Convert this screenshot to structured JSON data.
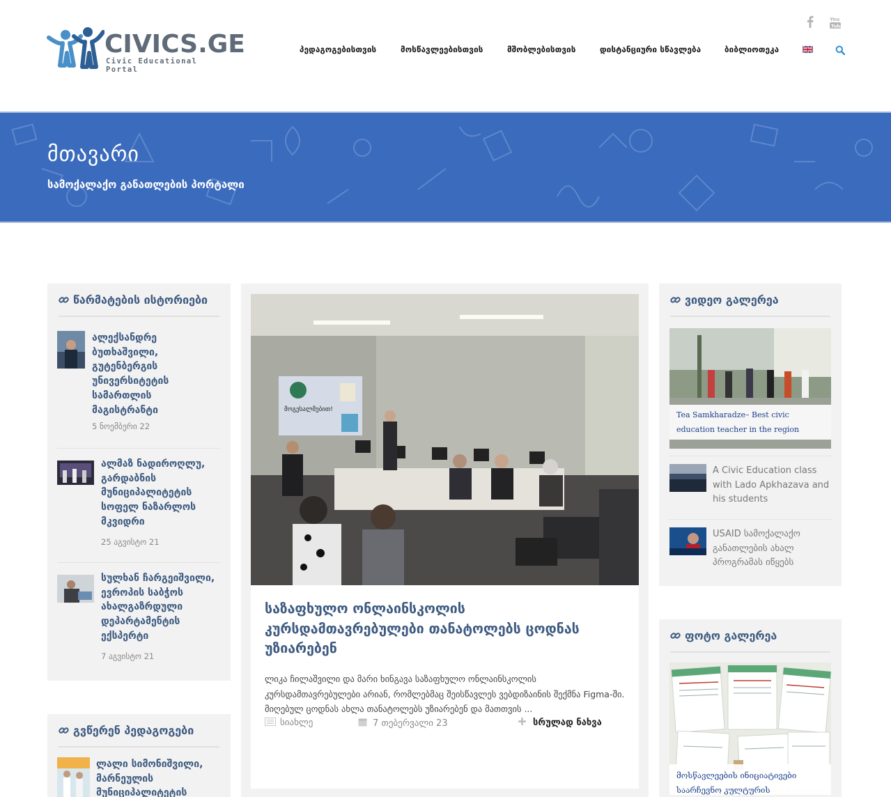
{
  "header": {
    "logo_title": "CIVICS.GE",
    "logo_subtitle": "Civic Educational Portal",
    "nav": [
      "პედაგოგებისთვის",
      "მოსწავლეებისთვის",
      "მშობლებისთვის",
      "დისტანციური სწავლება",
      "ბიბლიოთეკა"
    ],
    "social_icons": [
      "facebook-icon",
      "youtube-icon"
    ],
    "language_icon": "uk-flag-icon",
    "search_icon": "search-icon"
  },
  "banner": {
    "title": "მთავარი",
    "subtitle": "სამოქალაქო განათლების პორტალი",
    "color": "#3b6bbd"
  },
  "success_stories": {
    "title": "წარმატების ისტორიები",
    "items": [
      {
        "title": "ალექსანდრე ბუთხაშვილი, გუტენბერგის უნივერსიტეტის სამართლის მაგისტრანტი",
        "date": "5 ნოემბერი 22"
      },
      {
        "title": "ალმაზ ნადიროღლუ, გარდაბნის მუნიციპალიტეტის სოფელ ნაზარლოს მკვიდრი",
        "date": "25 აგვისტო 21"
      },
      {
        "title": "სულხან ჩარგეიშვილი, ევროპის საბჭოს ახალგაზრდული დეპარტამენტის ექსპერტი",
        "date": "7 აგვისტო 21"
      }
    ]
  },
  "teachers": {
    "title": "გვწერენ პედაგოგები",
    "items": [
      {
        "title": "ლალი სიმონიშვილი, მარნეულის მუნიციპალიტეტის"
      }
    ]
  },
  "post": {
    "title": "საზაფხულო ონლაინსკოლის კურსდამთავრებულები თანატოლებს ცოდნას უზიარებენ",
    "excerpt": "ლიკა ჩილაშვილი და მარი ხინგავა საზაფხულო ონლაინსკოლის კურსდამთავრებულები არიან, რომლებმაც შეისწავლეს ვებდიზაინის შექმნა Figma-ში. მიღებულ ცოდნას ახლა თანატოლებს უზიარებენ და მათთვის ...",
    "category": "სიახლე",
    "date": "7 თებერვალი 23",
    "read_more": "სრულად ნახვა",
    "slide_text": "მოგესალმებით!"
  },
  "video_gallery": {
    "title": "ვიდეო გალერეა",
    "featured_caption": "Tea Samkharadze– Best civic education teacher in the region",
    "items": [
      {
        "title": "A Civic Education class with Lado Apkhazava and his students"
      },
      {
        "title": "USAID სამოქალაქო განათლების ახალ პროგრამას იწყებს"
      }
    ]
  },
  "photo_gallery": {
    "title": "ფოტო გალერეა",
    "featured_caption": "მოსწავლეების ინიციატივები საარჩევნო კულტურის"
  }
}
